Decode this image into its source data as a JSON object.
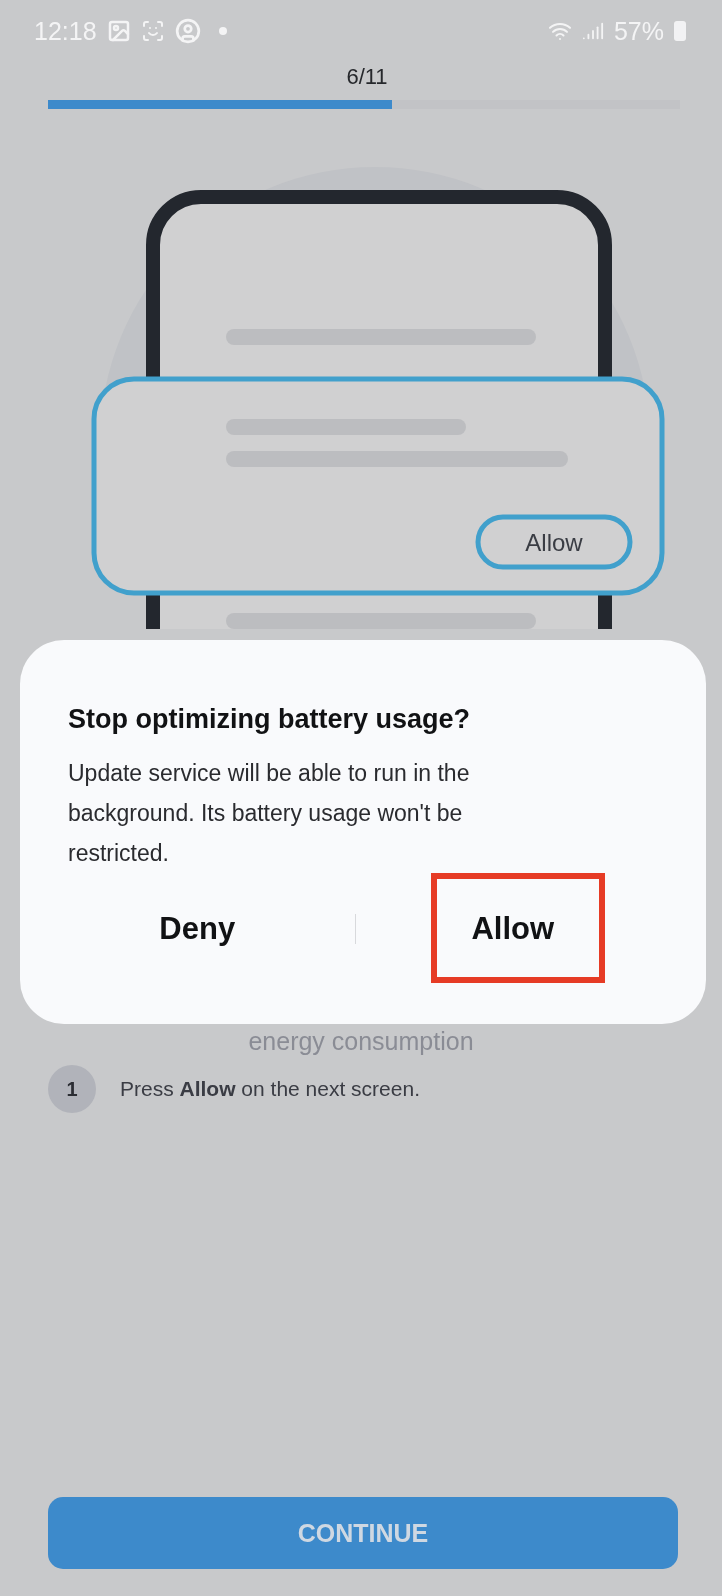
{
  "status_bar": {
    "time": "12:18",
    "battery": "57%"
  },
  "progress": {
    "counter": "6/11",
    "level": 0.545
  },
  "illustration": {
    "button_label": "Allow"
  },
  "subtitle": "energy consumption",
  "steps": [
    {
      "number": "1",
      "text": "Press **Allow** on the next screen."
    }
  ],
  "continue_button": "CONTINUE",
  "dialog": {
    "title": "Stop optimizing battery usage?",
    "message": "Update service will be able to run in the background. Its battery usage won't be restricted.",
    "buttons": [
      {
        "label": "Deny",
        "highlighted": false
      },
      {
        "label": "Allow",
        "highlighted": true
      }
    ]
  }
}
